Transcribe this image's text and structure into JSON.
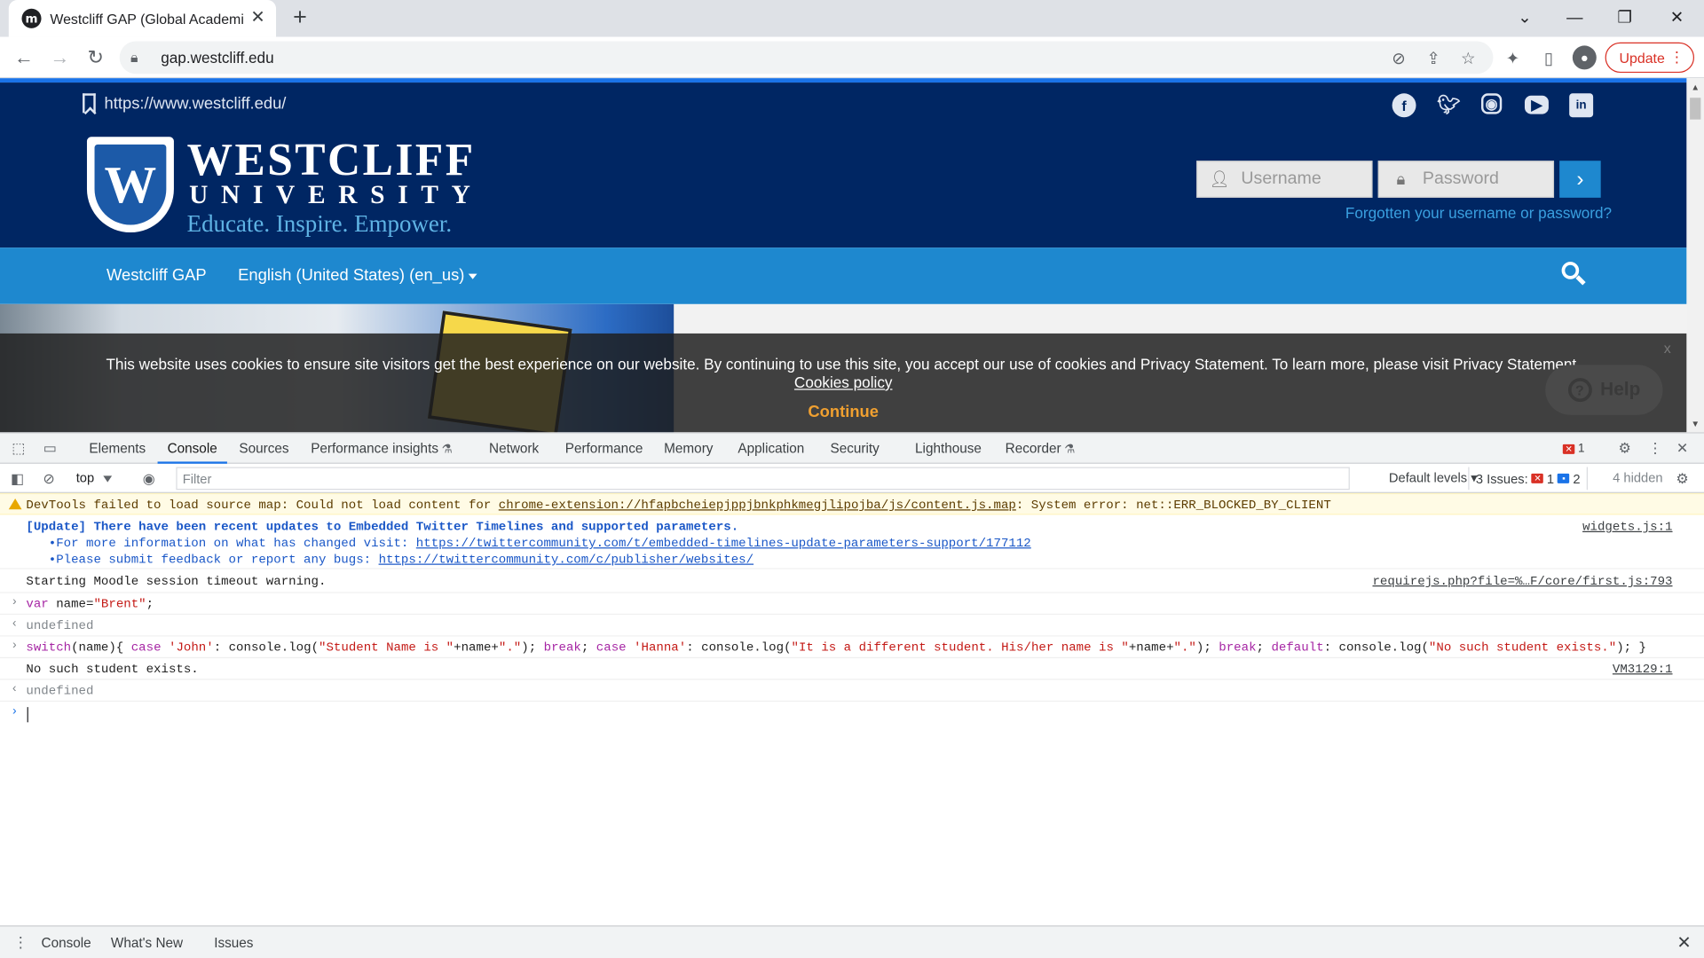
{
  "browser": {
    "tab_title": "Westcliff GAP (Global Academic Pathways)",
    "favicon_letter": "m",
    "url": "gap.westcliff.edu",
    "update_label": "Update",
    "icons": [
      "back-icon",
      "forward-icon",
      "reload-icon",
      "lock-icon",
      "eye-off-icon",
      "share-icon",
      "star-icon",
      "puzzle-icon",
      "side-panel-icon",
      "profile-icon",
      "kebab-menu-icon"
    ]
  },
  "site": {
    "home_url": "https://www.westcliff.edu/",
    "logo": {
      "name": "WESTCLIFF",
      "sub": "UNIVERSITY",
      "tagline": "Educate. Inspire. Empower."
    },
    "social": [
      "facebook-icon",
      "twitter-icon",
      "instagram-icon",
      "youtube-icon",
      "linkedin-icon"
    ],
    "login": {
      "username_placeholder": "Username",
      "password_placeholder": "Password",
      "forgot": "Forgotten your username or password?"
    },
    "nav": {
      "home": "Westcliff GAP",
      "language": "English (United States) (en_us)"
    },
    "cookie": {
      "text": "This website uses cookies to ensure site visitors get the best experience on our website. By continuing to use this site, you accept our use of cookies and Privacy Statement. To learn more, please visit Privacy Statement.",
      "policy": "Cookies policy",
      "continue": "Continue",
      "close": "x"
    },
    "help": "Help"
  },
  "devtools": {
    "tabs": [
      "Elements",
      "Console",
      "Sources",
      "Performance insights",
      "Network",
      "Performance",
      "Memory",
      "Application",
      "Security",
      "Lighthouse",
      "Recorder"
    ],
    "active_tab": "Console",
    "error_count": "1",
    "context": "top",
    "filter_placeholder": "Filter",
    "levels": "Default levels",
    "issues_label": "3 Issues:",
    "issues_errors": "1",
    "issues_info": "2",
    "hidden": "4 hidden",
    "console": {
      "warn_text": "DevTools failed to load source map: Could not load content for ",
      "warn_link": "chrome-extension://hfapbcheiepjppjbnkphkmegjlipojba/js/content.js.map",
      "warn_suffix": ": System error: net::ERR_BLOCKED_BY_CLIENT",
      "update_title": "[Update] There have been recent updates to Embedded Twitter Timelines and supported parameters.",
      "update_line1": "   •For more information on what has changed visit: ",
      "update_link1": "https://twittercommunity.com/t/embedded-timelines-update-parameters-support/177112",
      "update_line2": "   •Please submit feedback or report any bugs: ",
      "update_link2": "https://twittercommunity.com/c/publisher/websites/",
      "update_src": "widgets.js:1",
      "moodle_text": "Starting Moodle session timeout warning.",
      "moodle_src": "requirejs.php?file=%…F/core/first.js:793",
      "input1_kw": "var",
      "input1_rest": " name=",
      "input1_str": "\"Brent\"",
      "input1_end": ";",
      "result1": "undefined",
      "input2": {
        "p1": "switch",
        "p2": "(name){ ",
        "p3": "case",
        "p4": " ",
        "p5": "'John'",
        "p6": ": console.log(",
        "p7": "\"Student Name is \"",
        "p8": "+name+",
        "p9": "\".\"",
        "p10": "); ",
        "p11": "break",
        "p12": "; ",
        "p13": "case",
        "p14": " ",
        "p15": "'Hanna'",
        "p16": ": console.log(",
        "p17": "\"It is a different student. His/her name is \"",
        "p18": "+name+",
        "p19": "\".\"",
        "p20": "); ",
        "p21": "break",
        "p22": "; ",
        "p23": "default",
        "p24": ": console.log(",
        "p25": "\"No such student exists.\"",
        "p26": "); }"
      },
      "output2": "No such student exists.",
      "output2_src": "VM3129:1",
      "result2": "undefined"
    },
    "drawer_tabs": [
      "Console",
      "What's New",
      "Issues"
    ]
  },
  "colors": {
    "site_header": "#002663",
    "site_nav": "#1e88cf",
    "cookie_continue": "#f0a030",
    "update_red": "#d93025"
  }
}
